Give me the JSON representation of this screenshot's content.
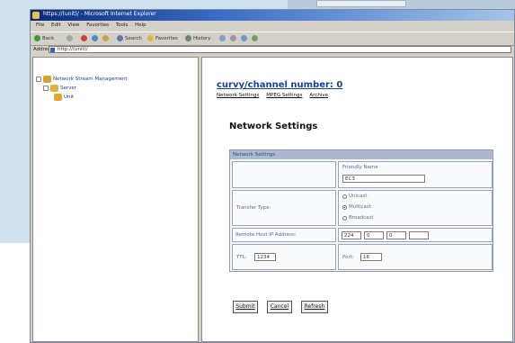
{
  "window": {
    "title": "https://(unit)/ - Microsoft Internet Explorer"
  },
  "menu": [
    "File",
    "Edit",
    "View",
    "Favorites",
    "Tools",
    "Help"
  ],
  "toolbar": {
    "back": "Back",
    "search": "Search",
    "favorites": "Favorites",
    "history": "History"
  },
  "address": {
    "label": "Address",
    "value": "http://(unit)/"
  },
  "tree": {
    "root": "Network Stream Management",
    "child": "Server",
    "grandchild": "Unit"
  },
  "content": {
    "heading": "curvy/channel number: 0",
    "subnav": [
      "Network Settings",
      "MPEG Settings",
      "Archive"
    ],
    "page_title": "Network Settings",
    "section_label": "Network Settings",
    "friendly_name_label": "Friendly Name",
    "friendly_name_value": "EC3",
    "transfer_type_label": "Transfer Type:",
    "transfer_options": [
      "Unicast",
      "Multicast",
      "Broadcast"
    ],
    "transfer_selected": "Multicast",
    "remote_host_label": "Remote Host IP Address:",
    "ip_octets": [
      "224",
      "0",
      "0",
      ""
    ],
    "ttl_label": "TTL:",
    "ttl_value": "1234",
    "port_label": "Port:",
    "port_value": "16"
  },
  "buttons": {
    "submit": "Submit",
    "cancel": "Cancel",
    "refresh": "Refresh"
  },
  "colors": {
    "accent": "#1840a8",
    "section_header": "#aab8d0",
    "titlebar": "#0a2a7a"
  }
}
